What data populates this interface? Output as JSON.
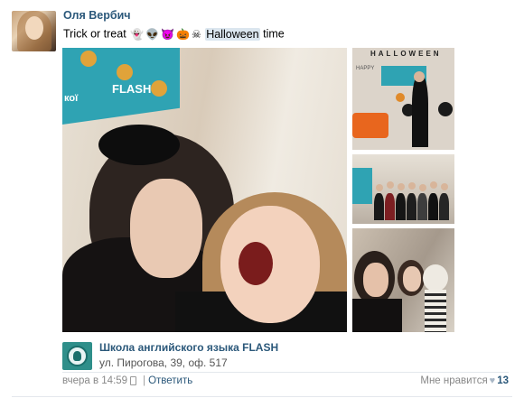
{
  "post": {
    "author": "Оля Вербич",
    "text_prefix": "Trick or treat",
    "emojis": [
      "ghost-icon",
      "alien-icon",
      "devil-icon",
      "pumpkin-icon",
      "skull-icon"
    ],
    "emoji_glyphs": [
      "👻",
      "👽",
      "😈",
      "🎃",
      "☠"
    ],
    "text_highlight": "Halloween",
    "text_suffix": "time",
    "group": {
      "name": "Школа английского языка FLASH",
      "address": "ул. Пирогова, 39, оф. 517"
    },
    "meta": {
      "time": "вчера в 14:59",
      "separator": "|",
      "reply": "Ответить"
    },
    "likes": {
      "label": "Мне нравится",
      "count": "13"
    }
  },
  "photo_texts": {
    "main_sign_word": "FLASH",
    "main_sign_prefix": "кої",
    "thumb1_heading": "HALLOWEEN",
    "thumb1_side": "HAPPY"
  },
  "colors": {
    "link": "#2b587a",
    "brand_teal": "#2fa3b3",
    "highlight": "#dbe6ef"
  }
}
